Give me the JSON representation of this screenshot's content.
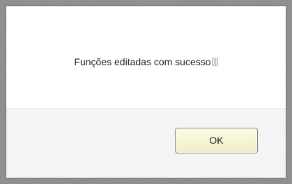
{
  "dialog": {
    "message": "Funções editadas com sucesso",
    "ok_label": "OK"
  }
}
